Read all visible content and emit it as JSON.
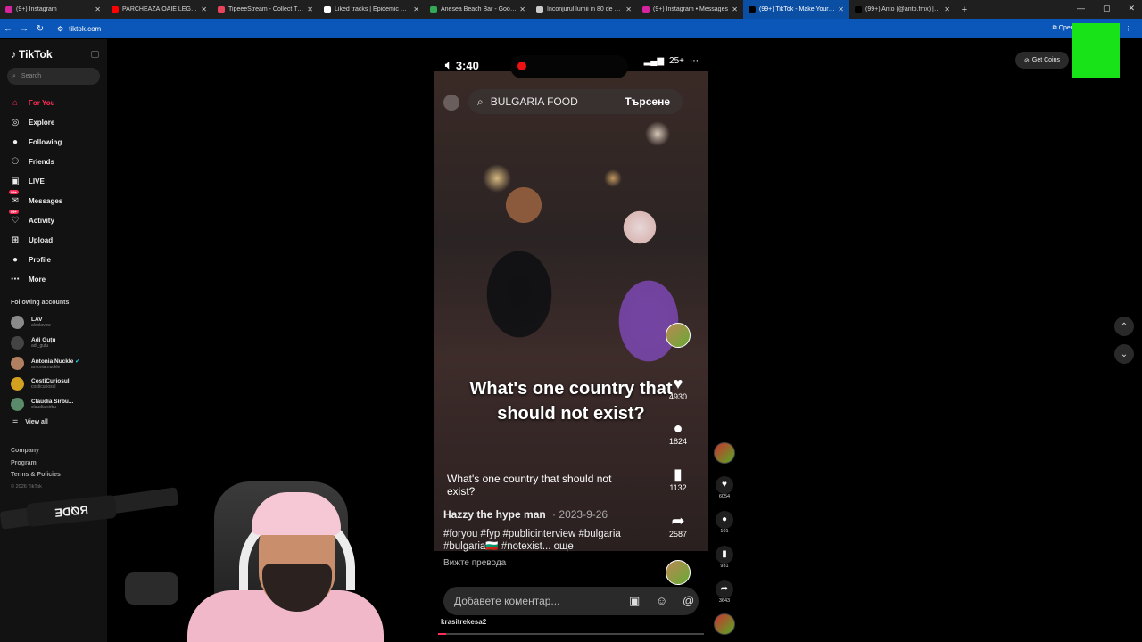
{
  "browser": {
    "tabs": [
      {
        "label": "(9+) Instagram",
        "color": "#d6249f",
        "active": false
      },
      {
        "label": "PARCHEAZĂ OAIE LEGAL! | Sălp...",
        "color": "#ff0000",
        "active": false
      },
      {
        "label": "TipeeeStream - Collect Tips wi...",
        "color": "#e8455a",
        "active": false
      },
      {
        "label": "Liked tracks | Epidemic Sound",
        "color": "#ffffff",
        "active": false
      },
      {
        "label": "Anesea Beach Bar - Google Ma...",
        "color": "#34a853",
        "active": false
      },
      {
        "label": "Inconjurul lumii in 80 de zile - ...",
        "color": "#cccccc",
        "active": false
      },
      {
        "label": "(9+) Instagram • Messages",
        "color": "#d6249f",
        "active": false
      },
      {
        "label": "(99+) TikTok - Make Your Da...",
        "color": "#000000",
        "active": true
      },
      {
        "label": "(99+) Anto (@anto.fmx) | TikTok",
        "color": "#000000",
        "active": false
      }
    ],
    "url": "tiktok.com",
    "open_in_app": "Open in app"
  },
  "sidebar": {
    "logo": "TikTok",
    "search_placeholder": "Search",
    "nav": [
      {
        "label": "For You",
        "icon": "home-icon",
        "glyph": "⌂",
        "active": true
      },
      {
        "label": "Explore",
        "icon": "compass-icon",
        "glyph": "◎",
        "active": false
      },
      {
        "label": "Following",
        "icon": "following-avatar",
        "glyph": "●",
        "active": false
      },
      {
        "label": "Friends",
        "icon": "friends-icon",
        "glyph": "⚇",
        "active": false
      },
      {
        "label": "LIVE",
        "icon": "live-icon",
        "glyph": "▣",
        "active": false
      },
      {
        "label": "Messages",
        "icon": "messages-icon",
        "glyph": "✉",
        "active": false,
        "badge": "99+"
      },
      {
        "label": "Activity",
        "icon": "activity-icon",
        "glyph": "♡",
        "active": false,
        "badge": "99+"
      },
      {
        "label": "Upload",
        "icon": "upload-icon",
        "glyph": "⊞",
        "active": false
      },
      {
        "label": "Profile",
        "icon": "profile-avatar",
        "glyph": "●",
        "active": false
      },
      {
        "label": "More",
        "icon": "more-icon",
        "glyph": "⋯",
        "active": false
      }
    ],
    "following_title": "Following accounts",
    "accounts": [
      {
        "name": "LAV",
        "handle": "alexlavsw",
        "color": "#8a8a8a"
      },
      {
        "name": "Adi Guțu",
        "handle": "adi_gutu",
        "color": "#444444"
      },
      {
        "name": "Antonia Nuckle",
        "handle": "antonia.nuckle",
        "color": "#b08060",
        "verified": true
      },
      {
        "name": "CostiCuriosul",
        "handle": "costicuriosul",
        "color": "#d4a020"
      },
      {
        "name": "Claudia Sirbu...",
        "handle": "claudia.sirbu",
        "color": "#5a8a6a"
      }
    ],
    "view_all": "View all",
    "footer": [
      "Company",
      "Program",
      "Terms & Policies"
    ],
    "copyright": "© 2026 TikTok"
  },
  "header": {
    "get_coins": "Get Coins"
  },
  "video": {
    "status_time": "3:40",
    "battery": "25+",
    "search_text": "BULGARIA FOOD",
    "search_button": "Търсене",
    "headline": "What's one country that should not exist?",
    "caption": "What's one country that should not exist?",
    "author": "Hazzy the hype man",
    "date": "2023-9-26",
    "tags": "#foryou #fyp #publicinterview #bulgaria #bulgaria🇧🇬 #notexist... още",
    "likes": "4930",
    "comments": "1824",
    "saves": "1132",
    "shares": "2587",
    "translate": "Вижте превода",
    "comment_placeholder": "Добавете коментар...",
    "account": "krasitrekesa2",
    "progress": 0.03
  },
  "actions": {
    "likes": "6054",
    "comments": "101",
    "saves": "931",
    "shares": "3643"
  },
  "overlay": {
    "mic_brand": "RØDE"
  }
}
